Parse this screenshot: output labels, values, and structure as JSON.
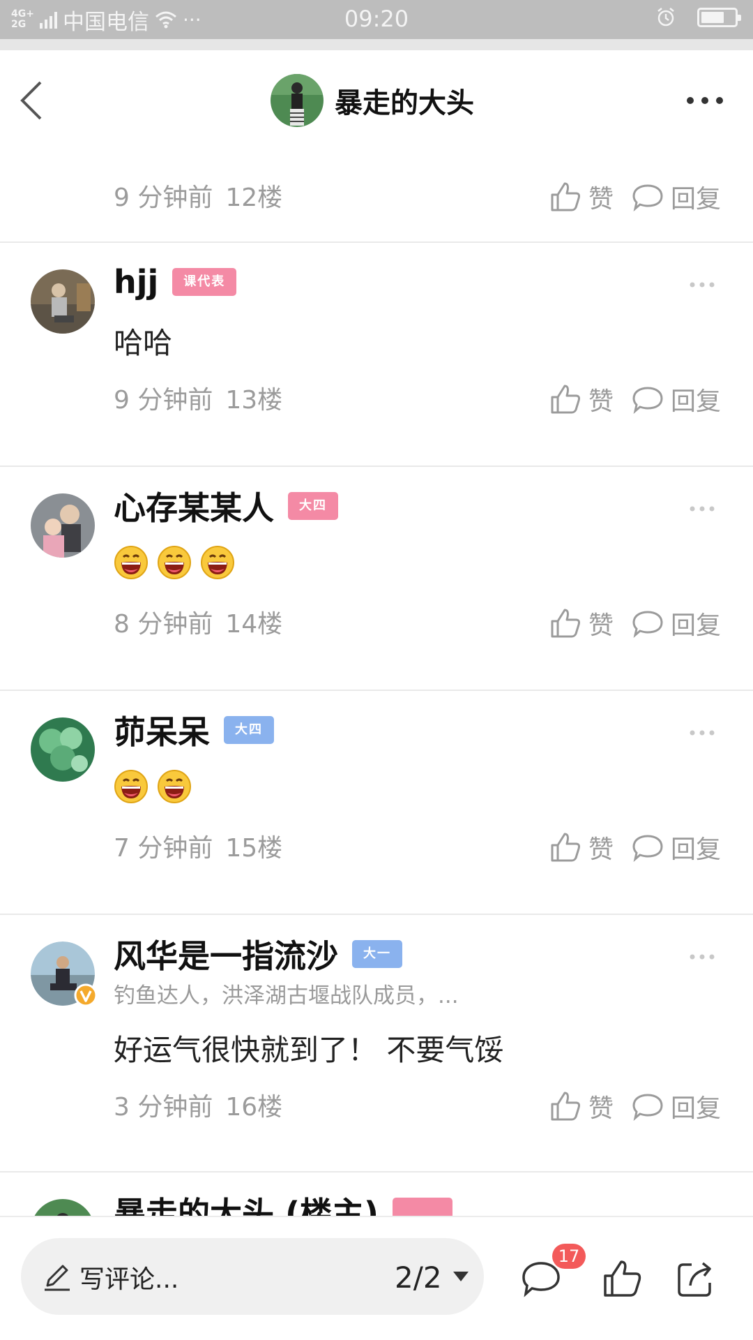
{
  "status_bar": {
    "network_top": "4G+",
    "network_bottom": "2G",
    "carrier": "中国电信",
    "extra": "···",
    "time": "09:20",
    "battery_level": 0.7,
    "icons": [
      "signal-icon",
      "wifi-icon",
      "alarm-icon",
      "battery-icon"
    ]
  },
  "header": {
    "title": "暴走的大头",
    "icons": [
      "back-chevron-icon",
      "more-horizontal-icon"
    ]
  },
  "actions": {
    "like_label": "赞",
    "reply_label": "回复"
  },
  "comments": [
    {
      "time": "9 分钟前",
      "floor": "12楼"
    },
    {
      "name": "hjj",
      "badge": "课代表",
      "badge_color": "#f48aa5",
      "content": "哈哈",
      "time": "9 分钟前",
      "floor": "13楼"
    },
    {
      "name": "心存某某人",
      "badge": "大四",
      "badge_color": "#f48aa5",
      "emoji_count": 3,
      "time": "8 分钟前",
      "floor": "14楼"
    },
    {
      "name": "茆呆呆",
      "badge": "大四",
      "badge_color": "#8ab2ee",
      "emoji_count": 2,
      "time": "7 分钟前",
      "floor": "15楼"
    },
    {
      "name": "风华是一指流沙",
      "badge": "大一",
      "badge_color": "#8ab2ee",
      "subtitle": "钓鱼达人，洪泽湖古堰战队成员，...",
      "verified": true,
      "content": "好运气很快就到了！ 不要气馁",
      "time": "3 分钟前",
      "floor": "16楼"
    },
    {
      "name": "暴走的大头 (楼主)",
      "badge_color": "#f48aa5",
      "partial": true
    }
  ],
  "bottom_bar": {
    "input_placeholder": "写评论...",
    "page_indicator": "2/2",
    "comment_count": "17",
    "icons": [
      "pen-icon",
      "caret-down-icon",
      "comment-icon",
      "like-icon",
      "share-icon"
    ]
  },
  "colors": {
    "status_bar_bg": "#bdbdbd",
    "badge_pink": "#f48aa5",
    "badge_blue": "#8ab2ee",
    "notification_red": "#f35a5a",
    "meta_gray": "#9b9b9b"
  }
}
